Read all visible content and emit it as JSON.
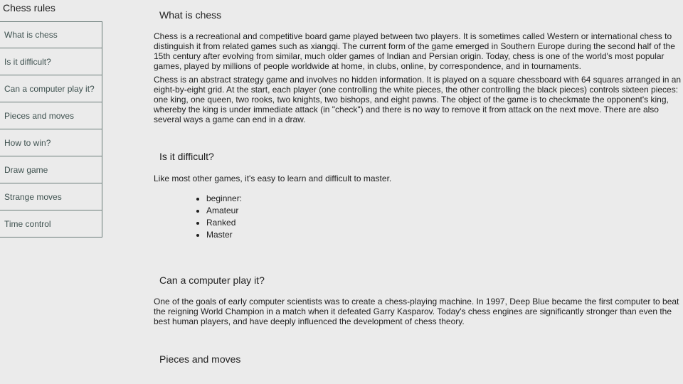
{
  "sidebar": {
    "title": "Chess rules",
    "items": [
      {
        "label": "What is chess"
      },
      {
        "label": "Is it difficult?"
      },
      {
        "label": "Can a computer play it?"
      },
      {
        "label": "Pieces and moves"
      },
      {
        "label": "How to win?"
      },
      {
        "label": "Draw game"
      },
      {
        "label": "Strange moves"
      },
      {
        "label": "Time control"
      }
    ]
  },
  "sections": {
    "what_is_chess": {
      "heading": "What is chess",
      "paragraphs": [
        "Chess is a recreational and competitive board game played between two players. It is sometimes called Western or international chess to distinguish it from related games such as xiangqi. The current form of the game emerged in Southern Europe during the second half of the 15th century after evolving from similar, much older games of Indian and Persian origin. Today, chess is one of the world's most popular games, played by millions of people worldwide at home, in clubs, online, by correspondence, and in tournaments.",
        "Chess is an abstract strategy game and involves no hidden information. It is played on a square chessboard with 64 squares arranged in an eight-by-eight grid. At the start, each player (one controlling the white pieces, the other controlling the black pieces) controls sixteen pieces: one king, one queen, two rooks, two knights, two bishops, and eight pawns. The object of the game is to checkmate the opponent's king, whereby the king is under immediate attack (in \"check\") and there is no way to remove it from attack on the next move. There are also several ways a game can end in a draw."
      ]
    },
    "is_it_difficult": {
      "heading": "Is it difficult?",
      "paragraph": "Like most other games, it's easy to learn and difficult to master.",
      "levels": [
        "beginner:",
        "Amateur",
        "Ranked",
        "Master"
      ]
    },
    "computer": {
      "heading": "Can a computer play it?",
      "paragraph": "One of the goals of early computer scientists was to create a chess-playing machine. In 1997, Deep Blue became the first computer to beat the reigning World Champion in a match when it defeated Garry Kasparov. Today's chess engines are significantly stronger than even the best human players, and have deeply influenced the development of chess theory."
    },
    "pieces_and_moves": {
      "heading": "Pieces and moves"
    }
  }
}
